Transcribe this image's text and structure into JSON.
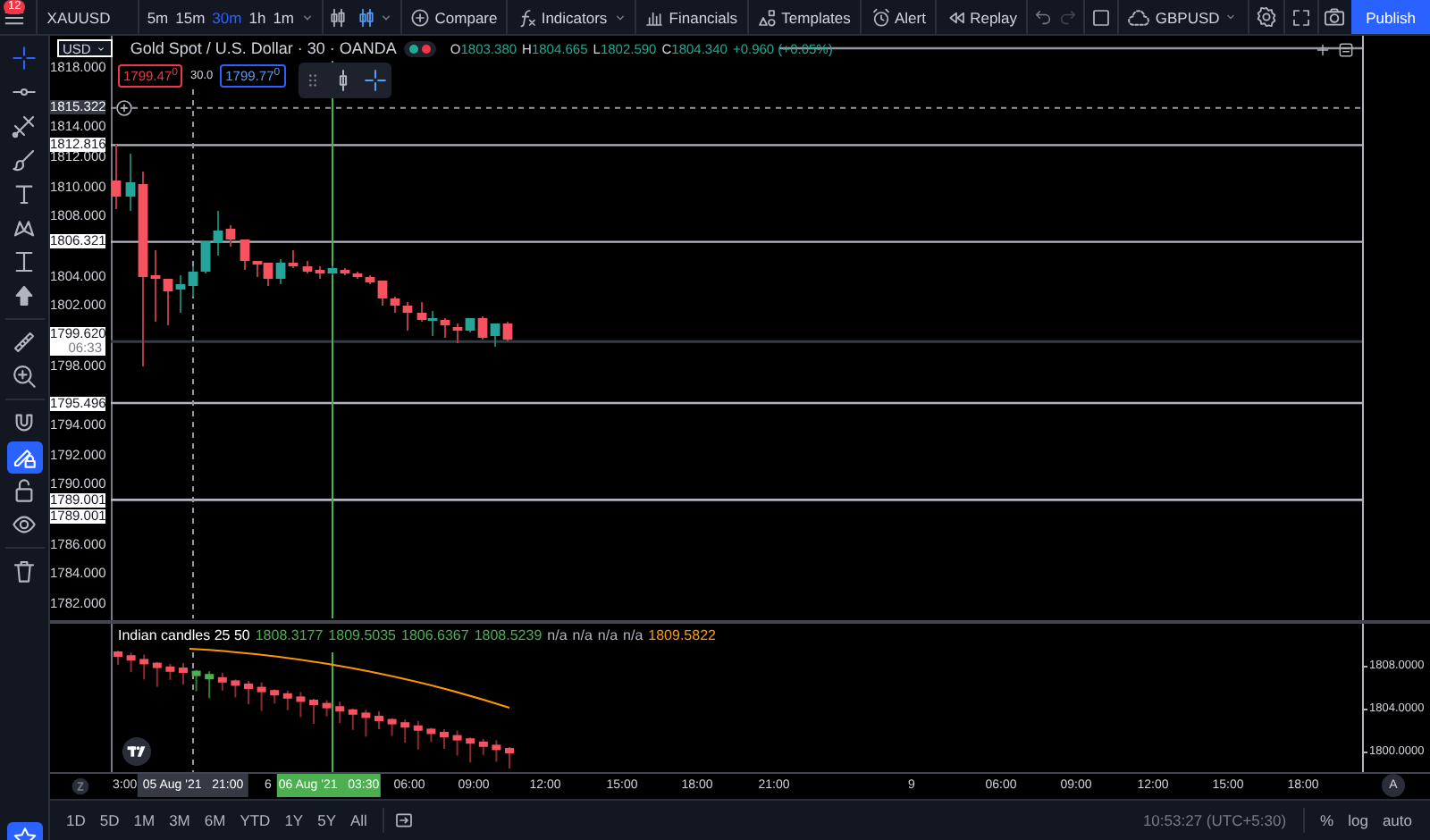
{
  "toolbar": {
    "menu_badge": "12",
    "symbol": "XAUUSD",
    "intervals": [
      {
        "label": "5m",
        "selected": false
      },
      {
        "label": "15m",
        "selected": false
      },
      {
        "label": "30m",
        "selected": true
      },
      {
        "label": "1h",
        "selected": false
      },
      {
        "label": "1m",
        "selected": false
      }
    ],
    "buttons": [
      {
        "kind": "compare",
        "label": "Compare"
      },
      {
        "kind": "indicators",
        "label": "Indicators"
      },
      {
        "kind": "financials",
        "label": "Financials"
      },
      {
        "kind": "templates",
        "label": "Templates"
      },
      {
        "kind": "alert",
        "label": "Alert"
      },
      {
        "kind": "replay",
        "label": "Replay"
      }
    ],
    "watchlist": "GBPUSD",
    "publish": "Publish"
  },
  "tool_groups": [
    [
      {
        "kind": "crosshair",
        "active": true
      },
      {
        "kind": "hline",
        "active": false
      },
      {
        "kind": "crossed",
        "active": false
      },
      {
        "kind": "brush",
        "active": false
      },
      {
        "kind": "text",
        "active": false
      },
      {
        "kind": "pattern",
        "active": false
      },
      {
        "kind": "measure",
        "active": false
      },
      {
        "kind": "arrow",
        "active": false
      }
    ],
    [
      {
        "kind": "ruler",
        "active": false
      },
      {
        "kind": "zoom",
        "active": false
      }
    ],
    [
      {
        "kind": "magnet",
        "active": false
      },
      {
        "kind": "pencillock",
        "active": true
      },
      {
        "kind": "lock",
        "active": false
      },
      {
        "kind": "eye",
        "active": false
      }
    ],
    [
      {
        "kind": "trash",
        "active": false
      }
    ]
  ],
  "chart": {
    "currency": "USD",
    "title": "Gold Spot / U.S. Dollar · 30 · OANDA",
    "status_dots": [
      {
        "color": "#22ab94"
      },
      {
        "color": "#f23645"
      }
    ],
    "ohlc": [
      {
        "label": "O",
        "value": "1803.380"
      },
      {
        "label": "H",
        "value": "1804.665"
      },
      {
        "label": "L",
        "value": "1802.590"
      },
      {
        "label": "C",
        "value": "1804.340"
      }
    ],
    "change": "+0.960 (+0.05%)",
    "sell_price": "1799.47$^{0}$",
    "spread": "30.0",
    "buy_price": "1799.77$^{0}$",
    "price_ticks": [
      "1818.000",
      "1814.000",
      "1812.000",
      "1810.000",
      "1808.000",
      "1804.000",
      "1802.000",
      "1798.000",
      "1794.000",
      "1792.000",
      "1790.000",
      "1786.000",
      "1784.000",
      "1782.000"
    ],
    "price_labels": [
      {
        "text": "1815.322",
        "kind": "crosshair"
      },
      {
        "text": "1812.816",
        "kind": "line"
      },
      {
        "text": "1806.321",
        "kind": "line"
      },
      {
        "text": "1799.620",
        "countdown": "06:33",
        "kind": "last"
      },
      {
        "text": "1795.496",
        "kind": "line"
      },
      {
        "text": "1789.001",
        "kind": "line"
      },
      {
        "text": "1789.001",
        "kind": "line"
      }
    ]
  },
  "indicator": {
    "name": "Indian candles 25 50",
    "values": [
      {
        "text": "1808.3177",
        "color": "#4caf50"
      },
      {
        "text": "1809.5035",
        "color": "#4caf50"
      },
      {
        "text": "1806.6367",
        "color": "#4caf50"
      },
      {
        "text": "1808.5239",
        "color": "#4caf50"
      },
      {
        "text": "n/a",
        "color": "#b2b5be"
      },
      {
        "text": "n/a",
        "color": "#b2b5be"
      },
      {
        "text": "n/a",
        "color": "#b2b5be"
      },
      {
        "text": "n/a",
        "color": "#b2b5be"
      },
      {
        "text": "1809.5822",
        "color": "#ff9800"
      }
    ],
    "ticks": [
      "1808.0000",
      "1804.0000",
      "1800.0000"
    ]
  },
  "time_axis": {
    "labels": [
      {
        "text": "3:00",
        "kind": "tick"
      },
      {
        "text": "05 Aug '21   21:00",
        "kind": "crosshair"
      },
      {
        "text": "6",
        "kind": "tick"
      },
      {
        "text": "06 Aug '21   03:30",
        "kind": "cursor"
      },
      {
        "text": "06:00",
        "kind": "tick"
      },
      {
        "text": "09:00",
        "kind": "tick"
      },
      {
        "text": "12:00",
        "kind": "tick"
      },
      {
        "text": "15:00",
        "kind": "tick"
      },
      {
        "text": "18:00",
        "kind": "tick"
      },
      {
        "text": "21:00",
        "kind": "tick"
      },
      {
        "text": "9",
        "kind": "tick"
      },
      {
        "text": "06:00",
        "kind": "tick"
      },
      {
        "text": "09:00",
        "kind": "tick"
      },
      {
        "text": "12:00",
        "kind": "tick"
      },
      {
        "text": "15:00",
        "kind": "tick"
      },
      {
        "text": "18:00",
        "kind": "tick"
      }
    ],
    "auto_scale": "A"
  },
  "bottom_bar": {
    "ranges": [
      "1D",
      "5D",
      "1M",
      "3M",
      "6M",
      "YTD",
      "1Y",
      "5Y",
      "All"
    ],
    "clock": "10:53:27 (UTC+5:30)",
    "scale_toggles": [
      "%",
      "log",
      "auto"
    ]
  }
}
